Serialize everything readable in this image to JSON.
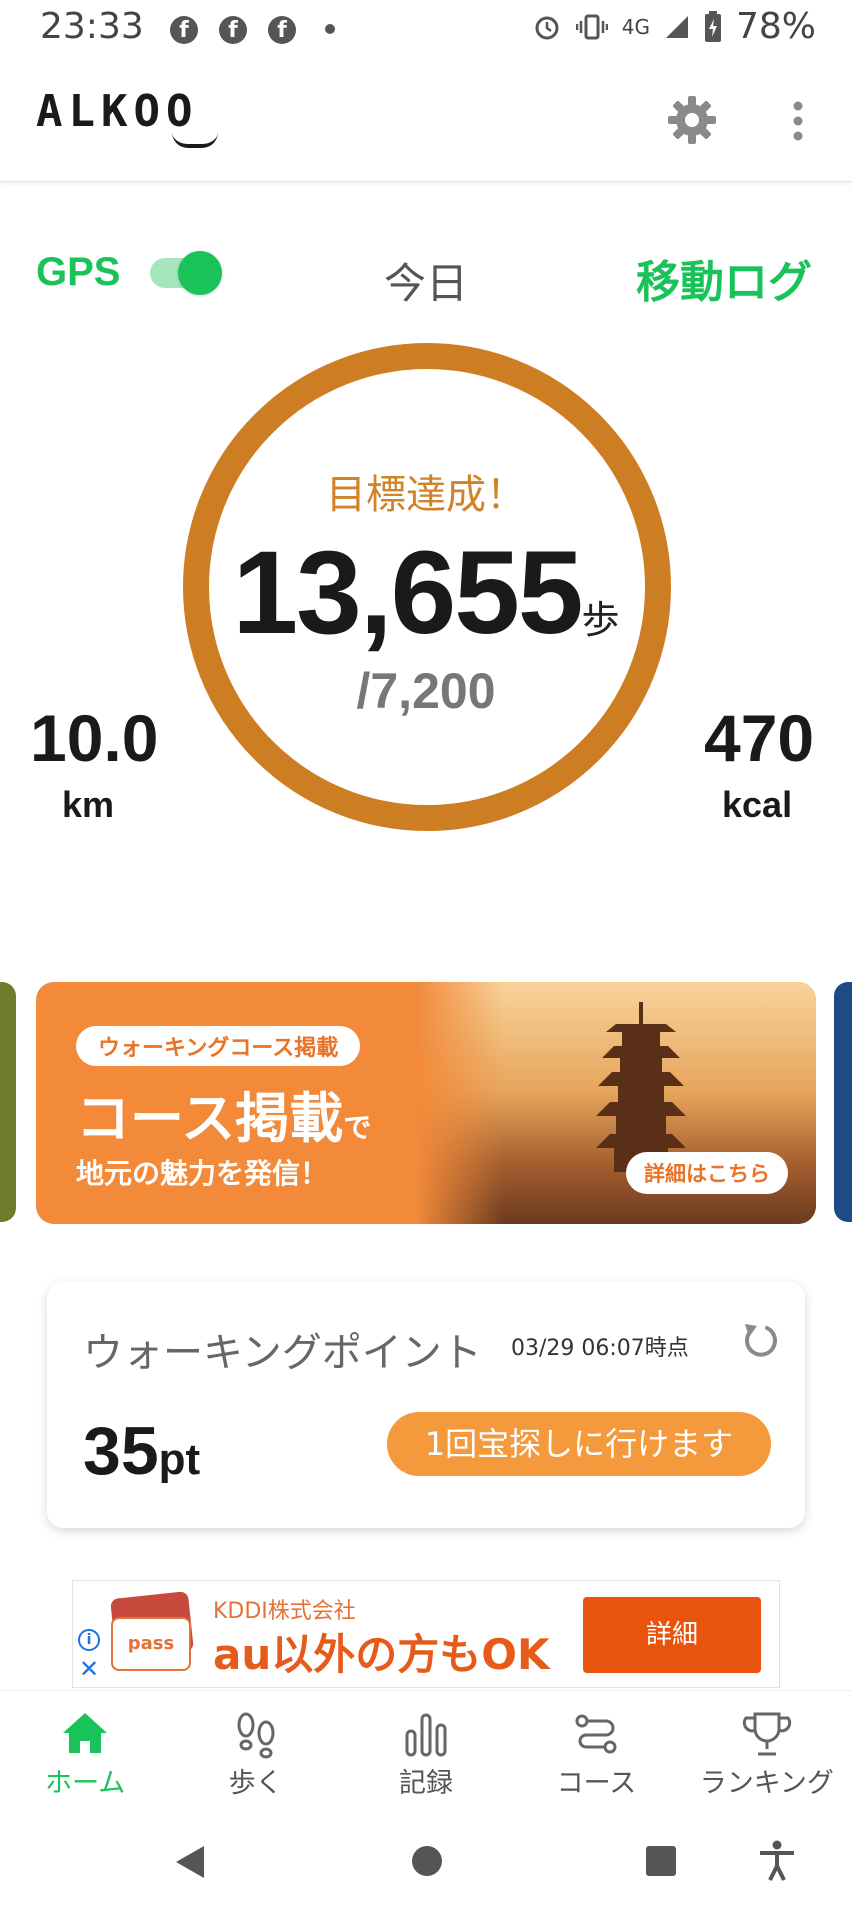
{
  "status_bar": {
    "time": "23:33",
    "network": "4G",
    "battery": "78%",
    "facebook_glyph": "f"
  },
  "app_bar": {
    "logo": "ALKOO"
  },
  "today": {
    "gps_label": "GPS",
    "gps_enabled": true,
    "title": "今日",
    "log_link": "移動ログ",
    "goal_status": "目標達成！",
    "steps": "13,655",
    "steps_unit": "歩",
    "steps_goal": "/7,200",
    "distance_value": "10.0",
    "distance_unit": "km",
    "calories_value": "470",
    "calories_unit": "kcal"
  },
  "banner": {
    "tag": "ウォーキングコース掲載",
    "title_main": "コース掲載",
    "title_suffix": "で",
    "subtitle": "地元の魅力を発信！",
    "detail_button": "詳細はこちら"
  },
  "walking_points": {
    "title": "ウォーキングポイント",
    "timestamp": "03/29 06:07時点",
    "points": "35",
    "points_unit": "pt",
    "action_button": "1回宝探しに行けます"
  },
  "ad": {
    "company": "KDDI株式会社",
    "headline": "au以外の方もOK",
    "button": "詳細",
    "card_label": "pass",
    "info_glyph": "i",
    "close_glyph": "✕"
  },
  "bottom_nav": {
    "items": [
      {
        "label": "ホーム",
        "icon": "home-icon",
        "active": true
      },
      {
        "label": "歩く",
        "icon": "footprints-icon",
        "active": false
      },
      {
        "label": "記録",
        "icon": "bar-chart-icon",
        "active": false
      },
      {
        "label": "コース",
        "icon": "route-icon",
        "active": false
      },
      {
        "label": "ランキング",
        "icon": "trophy-icon",
        "active": false
      }
    ]
  },
  "colors": {
    "accent_green": "#19c35a",
    "ring_orange": "#cd7e23",
    "banner_orange": "#f28a3a",
    "button_orange": "#f59a3c"
  }
}
